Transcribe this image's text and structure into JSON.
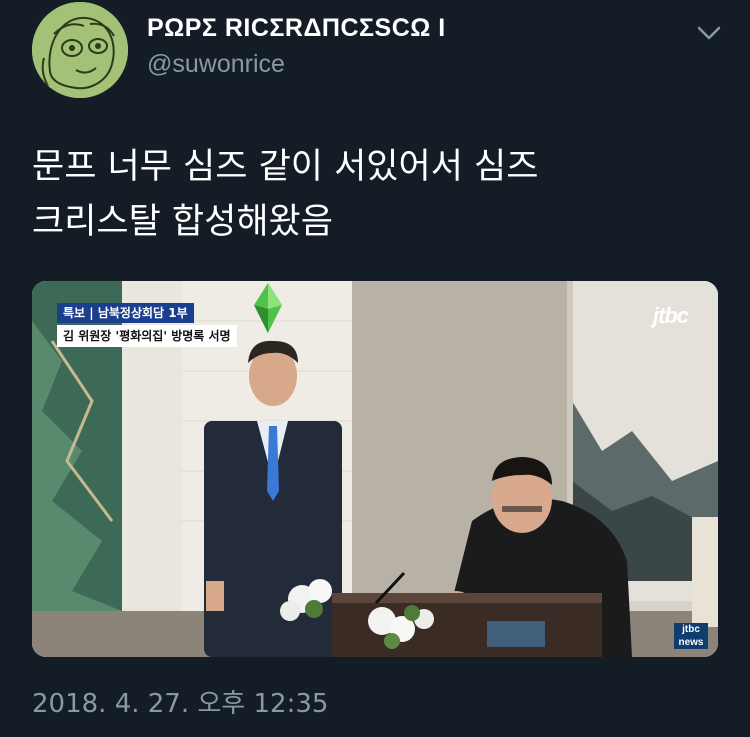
{
  "tweet": {
    "display_name": "ΡΩΡΣ RICΣRΔΠCΣSCΩ I",
    "handle": "@suwonrice",
    "text_lines": [
      "문프 너무 심즈 같이 서있어서 심즈",
      "크리스탈 합성해왔음"
    ],
    "timestamp": "2018. 4. 27. 오후 12:35"
  },
  "media": {
    "caption_line1": "특보 | 남북정상회담 1부",
    "caption_line2": "김 위원장 '평화의집' 방명록 서명",
    "logo": "jtbc",
    "logo_small_line1": "jtbc",
    "logo_small_line2": "news"
  },
  "icons": {
    "menu": "chevron-down-icon",
    "crystal": "plumbob-icon"
  },
  "colors": {
    "background": "#141d26",
    "secondary_text": "#8899a6",
    "crystal": "#4fc24a"
  }
}
